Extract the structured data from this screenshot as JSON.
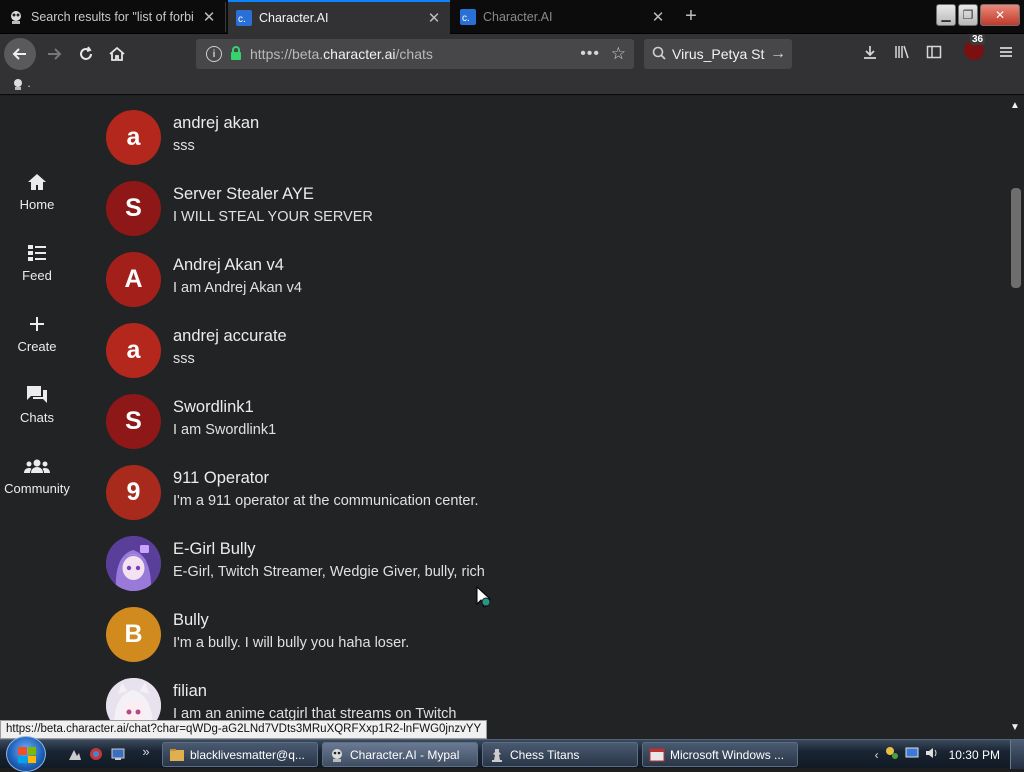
{
  "browser": {
    "tabs": [
      {
        "title": "Search results for \"list of forbi",
        "icon": "search-tab-icon",
        "active": false
      },
      {
        "title": "Character.AI",
        "icon": "characterai-favicon",
        "active": true
      },
      {
        "title": "Character.AI",
        "icon": "characterai-favicon",
        "active": false
      }
    ],
    "new_tab_label": "+",
    "url_prefix": "https://beta.",
    "url_domain": "character.ai",
    "url_path": "/chats",
    "search_value": "Virus_Petya St",
    "addon_badge": "36",
    "bookmark_label": "."
  },
  "sidenav": [
    {
      "label": "Home",
      "icon": "home-icon"
    },
    {
      "label": "Feed",
      "icon": "feed-icon"
    },
    {
      "label": "Create",
      "icon": "plus-icon"
    },
    {
      "label": "Chats",
      "icon": "chat-bubble-icon"
    },
    {
      "label": "Community",
      "icon": "people-icon"
    }
  ],
  "chats": [
    {
      "initial": "a",
      "name": "andrej akan",
      "message": "sss",
      "color": "#b3271c"
    },
    {
      "initial": "S",
      "name": "Server Stealer AYE",
      "message": "I WILL STEAL YOUR SERVER",
      "color": "#8e1717"
    },
    {
      "initial": "A",
      "name": "Andrej Akan v4",
      "message": "I am Andrej Akan v4",
      "color": "#a3201a"
    },
    {
      "initial": "a",
      "name": "andrej accurate",
      "message": "sss",
      "color": "#b3271c"
    },
    {
      "initial": "S",
      "name": "Swordlink1",
      "message": "I am Swordlink1",
      "color": "#8e1717"
    },
    {
      "initial": "9",
      "name": "911 Operator",
      "message": "I'm a 911 operator at the communication center.",
      "color": "#a82a1d"
    },
    {
      "initial": "",
      "name": "E-Girl Bully",
      "message": "E-Girl, Twitch Streamer, Wedgie Giver, bully, rich",
      "color": "#6a4aa8"
    },
    {
      "initial": "B",
      "name": "Bully",
      "message": "I'm a bully. I will bully you haha loser.",
      "color": "#d08a1e"
    },
    {
      "initial": "",
      "name": "filian",
      "message": "I am an anime catgirl that streams on Twitch",
      "color": "#d9d2e0"
    }
  ],
  "status_url": "https://beta.character.ai/chat?char=qWDg-aG2LNd7VDts3MRuXQRFXxp1R2-lnFWG0jnzvYY",
  "taskbar": {
    "tasks": [
      {
        "label": "blacklivesmatter@q...",
        "active": false
      },
      {
        "label": "Character.AI - Mypal",
        "active": true
      },
      {
        "label": "Chess Titans",
        "active": false
      },
      {
        "label": "Microsoft Windows ...",
        "active": false
      }
    ],
    "clock": "10:30 PM"
  }
}
